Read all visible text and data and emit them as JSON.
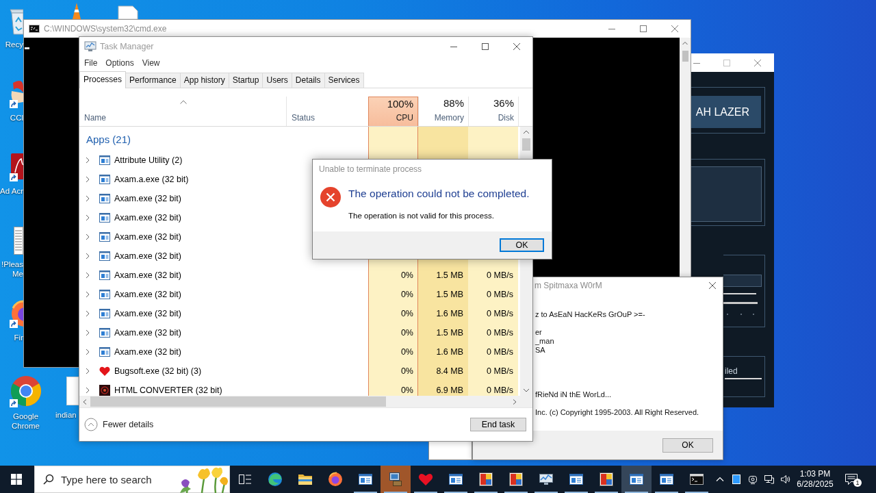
{
  "desktop": {
    "icons": [
      {
        "kind": "recycle-bin",
        "label": "Recy",
        "shortcut": false
      },
      {
        "kind": "brush",
        "label": "CCl",
        "shortcut": true
      },
      {
        "kind": "pdf",
        "label": "Ad Acr",
        "shortcut": true
      },
      {
        "kind": "document",
        "label": "!Pleas Me",
        "shortcut": false
      },
      {
        "kind": "globe",
        "label": "Fir",
        "shortcut": true
      },
      {
        "kind": "chrome",
        "label": "Google Chrome",
        "shortcut": true
      }
    ],
    "top_icons": [
      {
        "kind": "cone"
      },
      {
        "kind": "document"
      }
    ],
    "lower_icon": {
      "label": "indian"
    }
  },
  "cmd_window": {
    "title": "C:\\WINDOWS\\system32\\cmd.exe"
  },
  "lazer_window": {
    "button": "AH LAZER",
    "status": "iled"
  },
  "spitmaxa_dialog": {
    "title": "m Spitmaxa W0rM",
    "paragraphs": [
      [
        "z to AsEaN HacKeRs GrOuP >=-"
      ],
      [
        "er",
        "_man",
        "SA"
      ],
      [
        "fRieNd iN thE WorLd..."
      ],
      [
        "Inc. (c) Copyright 1995-2003. All Right Reserved."
      ]
    ],
    "button": {
      "label": "OK",
      "focused": false
    }
  },
  "task_manager": {
    "title": "Task Manager",
    "menu": [
      "File",
      "Options",
      "View"
    ],
    "tabs": [
      {
        "label": "Processes",
        "selected": true
      },
      {
        "label": "Performance",
        "selected": false
      },
      {
        "label": "App history",
        "selected": false
      },
      {
        "label": "Startup",
        "selected": false
      },
      {
        "label": "Users",
        "selected": false
      },
      {
        "label": "Details",
        "selected": false
      },
      {
        "label": "Services",
        "selected": false
      }
    ],
    "columns": [
      {
        "label": "Name",
        "sorted": true,
        "highlighted": false
      },
      {
        "label": "Status",
        "sorted": false,
        "highlighted": false
      },
      {
        "label": "CPU",
        "value": "100%",
        "sorted": false,
        "highlighted": true,
        "color": "#fdf2c4"
      },
      {
        "label": "Memory",
        "value": "88%",
        "sorted": false,
        "highlighted": false,
        "color": "#f8e4a0"
      },
      {
        "label": "Disk",
        "value": "36%",
        "sorted": false,
        "highlighted": false,
        "color": "#fdf2c4"
      }
    ],
    "group": "Apps (21)",
    "rows": [
      {
        "name": "Attribute Utility (2)",
        "kind": "window",
        "expanded": false
      },
      {
        "name": "Axam.a.exe (32 bit)",
        "kind": "window",
        "expanded": false
      },
      {
        "name": "Axam.exe (32 bit)",
        "kind": "window",
        "expanded": false
      },
      {
        "name": "Axam.exe (32 bit)",
        "kind": "window",
        "expanded": false
      },
      {
        "name": "Axam.exe (32 bit)",
        "kind": "window",
        "expanded": false
      },
      {
        "name": "Axam.exe (32 bit)",
        "kind": "window",
        "expanded": false
      },
      {
        "name": "Axam.exe (32 bit)",
        "kind": "window",
        "expanded": false,
        "values": [
          "0%",
          "1.5 MB",
          "0 MB/s"
        ]
      },
      {
        "name": "Axam.exe (32 bit)",
        "kind": "window",
        "expanded": false,
        "values": [
          "0%",
          "1.5 MB",
          "0 MB/s"
        ]
      },
      {
        "name": "Axam.exe (32 bit)",
        "kind": "window",
        "expanded": false,
        "values": [
          "0%",
          "1.6 MB",
          "0 MB/s"
        ]
      },
      {
        "name": "Axam.exe (32 bit)",
        "kind": "window",
        "expanded": false,
        "values": [
          "0%",
          "1.5 MB",
          "0 MB/s"
        ]
      },
      {
        "name": "Axam.exe (32 bit)",
        "kind": "window",
        "expanded": false,
        "values": [
          "0%",
          "1.6 MB",
          "0 MB/s"
        ]
      },
      {
        "name": "Bugsoft.exe (32 bit) (3)",
        "kind": "heart",
        "expanded": false,
        "values": [
          "0%",
          "8.4 MB",
          "0 MB/s"
        ]
      },
      {
        "name": "HTML CONVERTER (32 bit)",
        "kind": "dark",
        "expanded": false,
        "values": [
          "0%",
          "6.9 MB",
          "0 MB/s"
        ]
      }
    ],
    "fewer_details": "Fewer details",
    "end_task": "End task"
  },
  "error_dialog": {
    "title": "Unable to terminate process",
    "heading": "The operation could not be completed.",
    "message": "The operation is not valid for this process.",
    "button": {
      "label": "OK",
      "focused": true
    }
  },
  "taskbar": {
    "search": {
      "placeholder": "Type here to search"
    },
    "apps": [
      {
        "kind": "edge",
        "running": false,
        "flashing": false,
        "selected": false
      },
      {
        "kind": "folder",
        "running": false,
        "flashing": false,
        "selected": false
      },
      {
        "kind": "globe",
        "running": false,
        "flashing": false,
        "selected": false
      },
      {
        "kind": "window",
        "running": true,
        "flashing": false,
        "selected": false
      },
      {
        "kind": "computer",
        "running": true,
        "flashing": true,
        "selected": false
      },
      {
        "kind": "heart",
        "running": true,
        "flashing": false,
        "selected": false
      },
      {
        "kind": "window",
        "running": true,
        "flashing": false,
        "selected": false
      },
      {
        "kind": "tiles",
        "running": true,
        "flashing": false,
        "selected": false
      },
      {
        "kind": "tiles",
        "running": true,
        "flashing": false,
        "selected": false
      },
      {
        "kind": "monitor",
        "running": true,
        "flashing": false,
        "selected": false
      },
      {
        "kind": "window",
        "running": true,
        "flashing": false,
        "selected": false
      },
      {
        "kind": "tiles",
        "running": true,
        "flashing": false,
        "selected": false
      },
      {
        "kind": "window",
        "running": true,
        "flashing": false,
        "selected": true
      },
      {
        "kind": "window",
        "running": true,
        "flashing": false,
        "selected": false
      },
      {
        "kind": "console",
        "running": true,
        "flashing": false,
        "selected": false
      }
    ],
    "clock": {
      "time": "1:03 PM",
      "date": "6/28/2025"
    },
    "notifications": "1"
  }
}
